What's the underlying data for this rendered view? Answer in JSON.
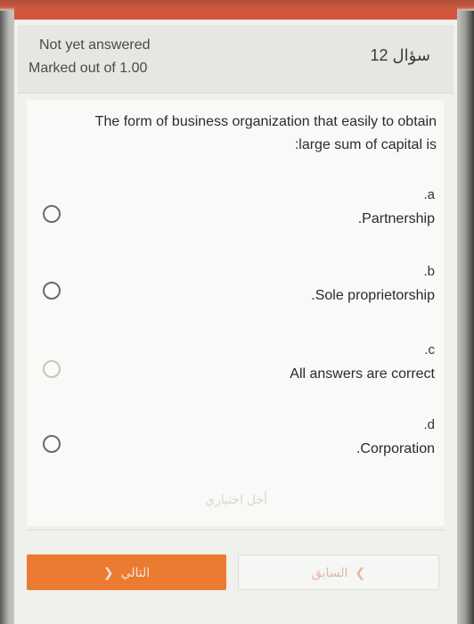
{
  "quiz": {
    "status": "Not yet answered",
    "marks": "Marked out of 1.00",
    "question_number": "سؤال 12"
  },
  "question": {
    "line1": "The form of business organization that easily to obtain",
    "line2": ":large sum of capital is"
  },
  "options": [
    {
      "letter": ".a",
      "text": ".Partnership"
    },
    {
      "letter": ".b",
      "text": ".Sole proprietorship"
    },
    {
      "letter": ".c",
      "text": "All answers are correct"
    },
    {
      "letter": ".d",
      "text": ".Corporation"
    }
  ],
  "clear_choice": "أخل اختياري",
  "nav": {
    "next_label": "التالي",
    "next_icon": "chevron-left-icon",
    "prev_label": "السابق",
    "prev_icon": "chevron-right-icon"
  },
  "colors": {
    "header": "#d0573e",
    "next_button": "#ea7b30"
  }
}
